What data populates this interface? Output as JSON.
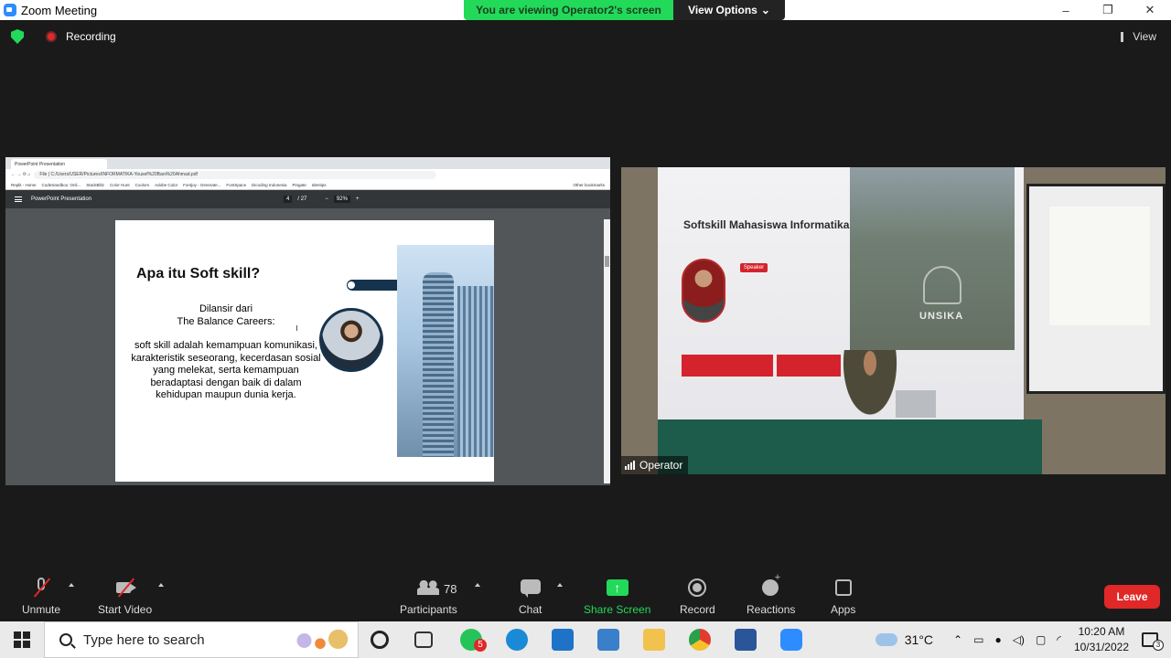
{
  "window": {
    "title": "Zoom Meeting",
    "controls": [
      "–",
      "❐",
      "✕"
    ]
  },
  "share_banner": {
    "viewing_text": "You are viewing Operator2's screen",
    "view_options_label": "View Options"
  },
  "status": {
    "recording_label": "Recording",
    "view_label": "View"
  },
  "shared_screen": {
    "browser_tab": "PowerPoint Presentation",
    "url": "C:/Users/USER/Pictures/INFORMATIKA-Yousef%20Bani%20Ahmad.pdf",
    "url_prefix": "File",
    "bookmarks": [
      "Replit - Home",
      "CodeSandbox: Onli...",
      "StackBlitz",
      "Color Hunt",
      "Coolors",
      "Adobe Color",
      "Fontjoy - Generate...",
      "FontSpace",
      "Dicoding Indonesia",
      "Pingate",
      "Identips"
    ],
    "other_bookmarks": "Other bookmarks",
    "pdf_title": "PowerPoint Presentation",
    "page_current": "4",
    "page_total": "/ 27",
    "zoom": "92%",
    "slide": {
      "title": "Apa itu Soft skill?",
      "source_line1": "Dilansir dari",
      "source_line2": "The Balance Careers:",
      "body": "soft skill adalah kemampuan komunikasi, karakteristik seseorang, kecerdasan sosial yang melekat, serta kemampuan beradaptasi dengan baik di dalam kehidupan maupun dunia kerja."
    }
  },
  "video": {
    "participant_name": "Operator",
    "banner_title": "Softskill Mahasiswa Informatika",
    "speaker_tag": "Speaker",
    "logo_text": "UNSIKA"
  },
  "toolbar": {
    "unmute": "Unmute",
    "start_video": "Start Video",
    "participants": "Participants",
    "participants_count": "78",
    "chat": "Chat",
    "share_screen": "Share Screen",
    "record": "Record",
    "reactions": "Reactions",
    "apps": "Apps",
    "leave": "Leave"
  },
  "taskbar": {
    "search_placeholder": "Type here to search",
    "whatsapp_badge": "5",
    "temperature": "31°C",
    "time": "10:20 AM",
    "date": "10/31/2022",
    "notifications": "3"
  },
  "colors": {
    "zoom_green": "#23d959",
    "leave_red": "#e02828",
    "slide_navy": "#15334d",
    "zoom_blue": "#2d8cff"
  }
}
